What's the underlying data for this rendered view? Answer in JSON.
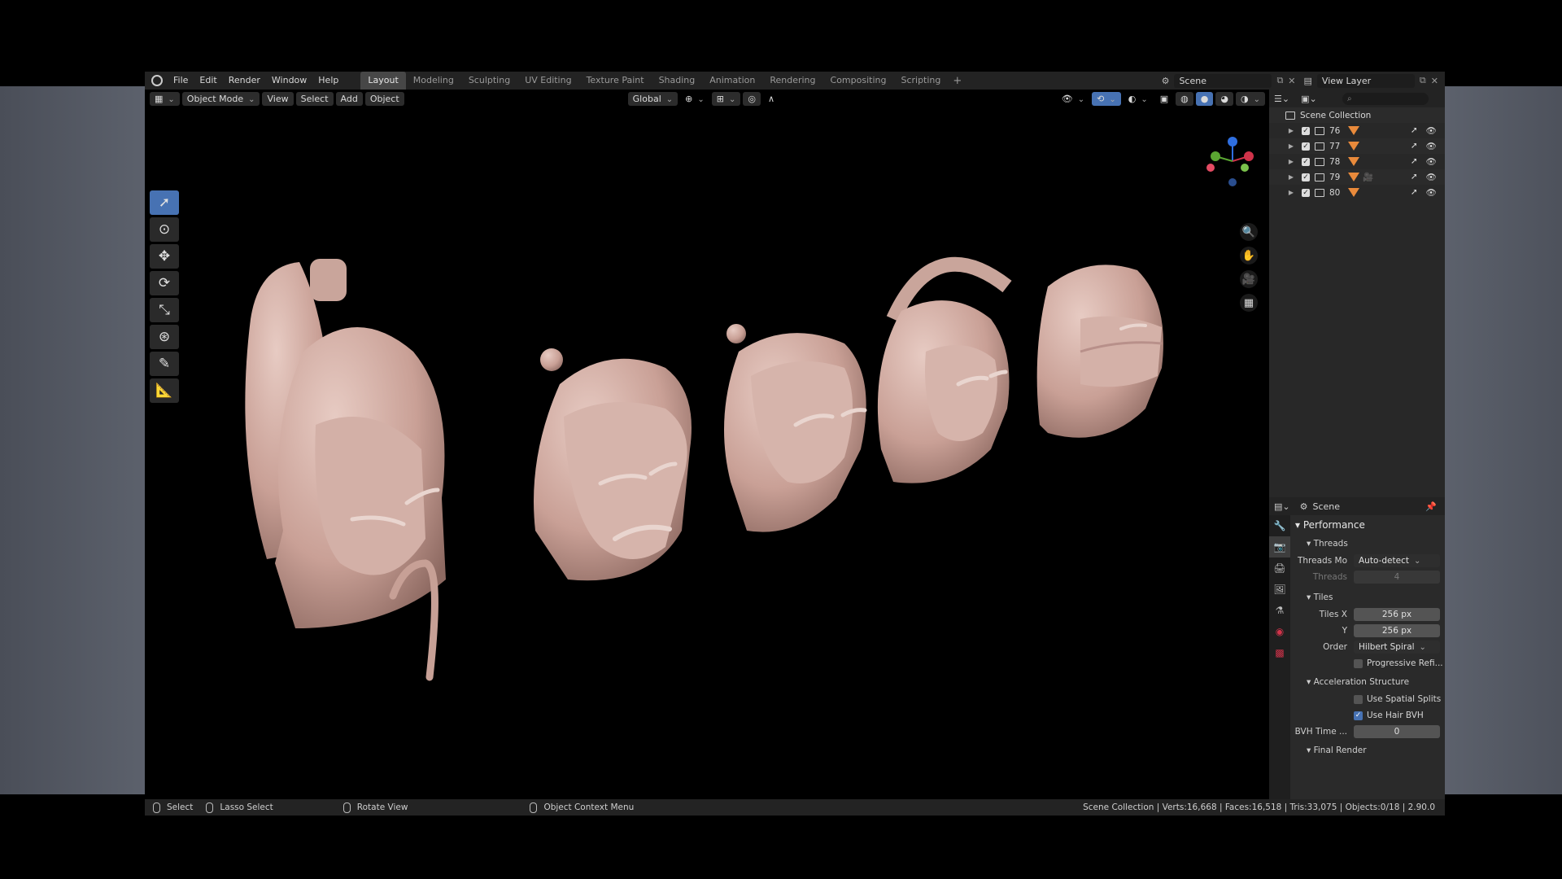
{
  "menu": [
    "File",
    "Edit",
    "Render",
    "Window",
    "Help"
  ],
  "workspaces": [
    "Layout",
    "Modeling",
    "Sculpting",
    "UV Editing",
    "Texture Paint",
    "Shading",
    "Animation",
    "Rendering",
    "Compositing",
    "Scripting"
  ],
  "active_workspace": "Layout",
  "scene_field": "Scene",
  "view_layer_field": "View Layer",
  "header": {
    "mode": "Object Mode",
    "view": "View",
    "select": "Select",
    "add": "Add",
    "object": "Object",
    "orientation": "Global"
  },
  "outliner": {
    "root": "Scene Collection",
    "items": [
      {
        "name": "76"
      },
      {
        "name": "77"
      },
      {
        "name": "78"
      },
      {
        "name": "79"
      },
      {
        "name": "80"
      }
    ]
  },
  "properties": {
    "context": "Scene",
    "performance": "Performance",
    "threads_section": "Threads",
    "threads_mode_label": "Threads Mo",
    "threads_mode_value": "Auto-detect",
    "threads_label": "Threads",
    "threads_value": "4",
    "tiles_section": "Tiles",
    "tiles_x_label": "Tiles X",
    "tiles_x_value": "256 px",
    "tiles_y_label": "Y",
    "tiles_y_value": "256 px",
    "order_label": "Order",
    "order_value": "Hilbert Spiral",
    "progressive": "Progressive Refi...",
    "accel_section": "Acceleration Structure",
    "spatial": "Use Spatial Splits",
    "hair_bvh": "Use Hair BVH",
    "bvh_time_label": "BVH Time ...",
    "bvh_time_value": "0",
    "final_render": "Final Render"
  },
  "status": {
    "select": "Select",
    "lasso": "Lasso Select",
    "rotate": "Rotate View",
    "context": "Object Context Menu",
    "stats": "Scene Collection | Verts:16,668 | Faces:16,518 | Tris:33,075 | Objects:0/18 | 2.90.0"
  },
  "colors": {
    "accent": "#4772b3",
    "mesh": "#e98a3b",
    "skin": "#d9b6ab"
  }
}
